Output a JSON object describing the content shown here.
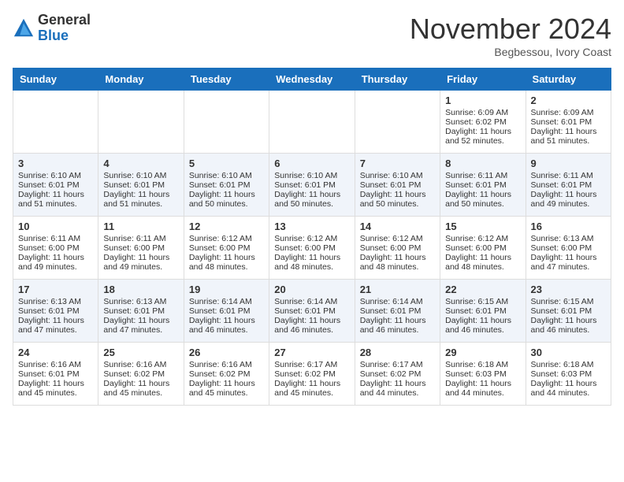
{
  "header": {
    "logo_general": "General",
    "logo_blue": "Blue",
    "month": "November 2024",
    "location": "Begbessou, Ivory Coast"
  },
  "days_of_week": [
    "Sunday",
    "Monday",
    "Tuesday",
    "Wednesday",
    "Thursday",
    "Friday",
    "Saturday"
  ],
  "weeks": [
    [
      {
        "day": "",
        "info": ""
      },
      {
        "day": "",
        "info": ""
      },
      {
        "day": "",
        "info": ""
      },
      {
        "day": "",
        "info": ""
      },
      {
        "day": "",
        "info": ""
      },
      {
        "day": "1",
        "info": "Sunrise: 6:09 AM\nSunset: 6:02 PM\nDaylight: 11 hours\nand 52 minutes."
      },
      {
        "day": "2",
        "info": "Sunrise: 6:09 AM\nSunset: 6:01 PM\nDaylight: 11 hours\nand 51 minutes."
      }
    ],
    [
      {
        "day": "3",
        "info": "Sunrise: 6:10 AM\nSunset: 6:01 PM\nDaylight: 11 hours\nand 51 minutes."
      },
      {
        "day": "4",
        "info": "Sunrise: 6:10 AM\nSunset: 6:01 PM\nDaylight: 11 hours\nand 51 minutes."
      },
      {
        "day": "5",
        "info": "Sunrise: 6:10 AM\nSunset: 6:01 PM\nDaylight: 11 hours\nand 50 minutes."
      },
      {
        "day": "6",
        "info": "Sunrise: 6:10 AM\nSunset: 6:01 PM\nDaylight: 11 hours\nand 50 minutes."
      },
      {
        "day": "7",
        "info": "Sunrise: 6:10 AM\nSunset: 6:01 PM\nDaylight: 11 hours\nand 50 minutes."
      },
      {
        "day": "8",
        "info": "Sunrise: 6:11 AM\nSunset: 6:01 PM\nDaylight: 11 hours\nand 50 minutes."
      },
      {
        "day": "9",
        "info": "Sunrise: 6:11 AM\nSunset: 6:01 PM\nDaylight: 11 hours\nand 49 minutes."
      }
    ],
    [
      {
        "day": "10",
        "info": "Sunrise: 6:11 AM\nSunset: 6:00 PM\nDaylight: 11 hours\nand 49 minutes."
      },
      {
        "day": "11",
        "info": "Sunrise: 6:11 AM\nSunset: 6:00 PM\nDaylight: 11 hours\nand 49 minutes."
      },
      {
        "day": "12",
        "info": "Sunrise: 6:12 AM\nSunset: 6:00 PM\nDaylight: 11 hours\nand 48 minutes."
      },
      {
        "day": "13",
        "info": "Sunrise: 6:12 AM\nSunset: 6:00 PM\nDaylight: 11 hours\nand 48 minutes."
      },
      {
        "day": "14",
        "info": "Sunrise: 6:12 AM\nSunset: 6:00 PM\nDaylight: 11 hours\nand 48 minutes."
      },
      {
        "day": "15",
        "info": "Sunrise: 6:12 AM\nSunset: 6:00 PM\nDaylight: 11 hours\nand 48 minutes."
      },
      {
        "day": "16",
        "info": "Sunrise: 6:13 AM\nSunset: 6:00 PM\nDaylight: 11 hours\nand 47 minutes."
      }
    ],
    [
      {
        "day": "17",
        "info": "Sunrise: 6:13 AM\nSunset: 6:01 PM\nDaylight: 11 hours\nand 47 minutes."
      },
      {
        "day": "18",
        "info": "Sunrise: 6:13 AM\nSunset: 6:01 PM\nDaylight: 11 hours\nand 47 minutes."
      },
      {
        "day": "19",
        "info": "Sunrise: 6:14 AM\nSunset: 6:01 PM\nDaylight: 11 hours\nand 46 minutes."
      },
      {
        "day": "20",
        "info": "Sunrise: 6:14 AM\nSunset: 6:01 PM\nDaylight: 11 hours\nand 46 minutes."
      },
      {
        "day": "21",
        "info": "Sunrise: 6:14 AM\nSunset: 6:01 PM\nDaylight: 11 hours\nand 46 minutes."
      },
      {
        "day": "22",
        "info": "Sunrise: 6:15 AM\nSunset: 6:01 PM\nDaylight: 11 hours\nand 46 minutes."
      },
      {
        "day": "23",
        "info": "Sunrise: 6:15 AM\nSunset: 6:01 PM\nDaylight: 11 hours\nand 46 minutes."
      }
    ],
    [
      {
        "day": "24",
        "info": "Sunrise: 6:16 AM\nSunset: 6:01 PM\nDaylight: 11 hours\nand 45 minutes."
      },
      {
        "day": "25",
        "info": "Sunrise: 6:16 AM\nSunset: 6:02 PM\nDaylight: 11 hours\nand 45 minutes."
      },
      {
        "day": "26",
        "info": "Sunrise: 6:16 AM\nSunset: 6:02 PM\nDaylight: 11 hours\nand 45 minutes."
      },
      {
        "day": "27",
        "info": "Sunrise: 6:17 AM\nSunset: 6:02 PM\nDaylight: 11 hours\nand 45 minutes."
      },
      {
        "day": "28",
        "info": "Sunrise: 6:17 AM\nSunset: 6:02 PM\nDaylight: 11 hours\nand 44 minutes."
      },
      {
        "day": "29",
        "info": "Sunrise: 6:18 AM\nSunset: 6:03 PM\nDaylight: 11 hours\nand 44 minutes."
      },
      {
        "day": "30",
        "info": "Sunrise: 6:18 AM\nSunset: 6:03 PM\nDaylight: 11 hours\nand 44 minutes."
      }
    ]
  ]
}
